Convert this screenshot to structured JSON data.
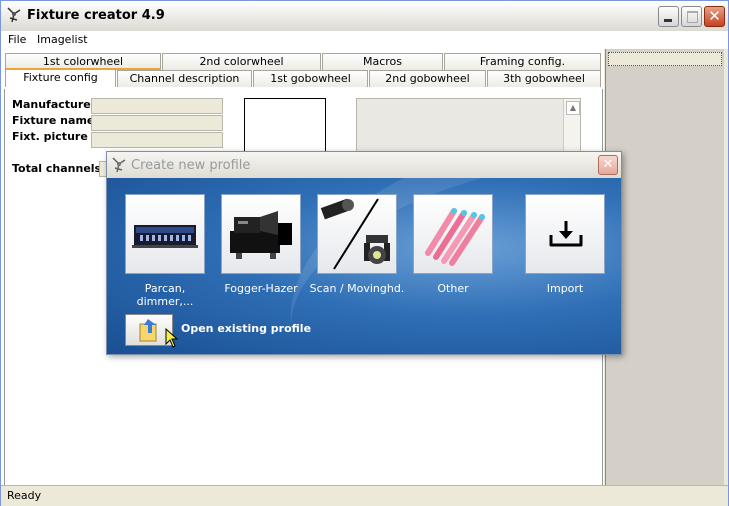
{
  "window": {
    "title": "Fixture creator 4.9"
  },
  "menu": [
    "File",
    "Imagelist"
  ],
  "tabs_row1": [
    "1st colorwheel",
    "2nd colorwheel",
    "Macros",
    "Framing config."
  ],
  "tabs_row2": [
    "Fixture config",
    "Channel description",
    "1st gobowheel",
    "2nd gobowheel",
    "3th gobowheel"
  ],
  "form": {
    "manufacturer_label": "Manufacturer",
    "fixture_name_label": "Fixture name",
    "fixture_picture_label": "Fixt. picture",
    "total_channels_label": "Total channels"
  },
  "dialog": {
    "title": "Create new profile",
    "tiles": [
      {
        "label": "Parcan, dimmer,...",
        "icon": "dimmer-pack-icon"
      },
      {
        "label": "Fogger-Hazer",
        "icon": "fog-machine-icon"
      },
      {
        "label": "Scan / Movinghd.",
        "icon": "moving-head-icon"
      },
      {
        "label": "Other",
        "icon": "led-tubes-icon"
      },
      {
        "label": "Import",
        "icon": "import-icon"
      }
    ],
    "open_label": "Open existing profile"
  },
  "status": "Ready",
  "colors": {
    "dialog_bg": "#2f6fb6",
    "tab_highlight": "#e9a53a",
    "window_border": "#7a96df"
  }
}
